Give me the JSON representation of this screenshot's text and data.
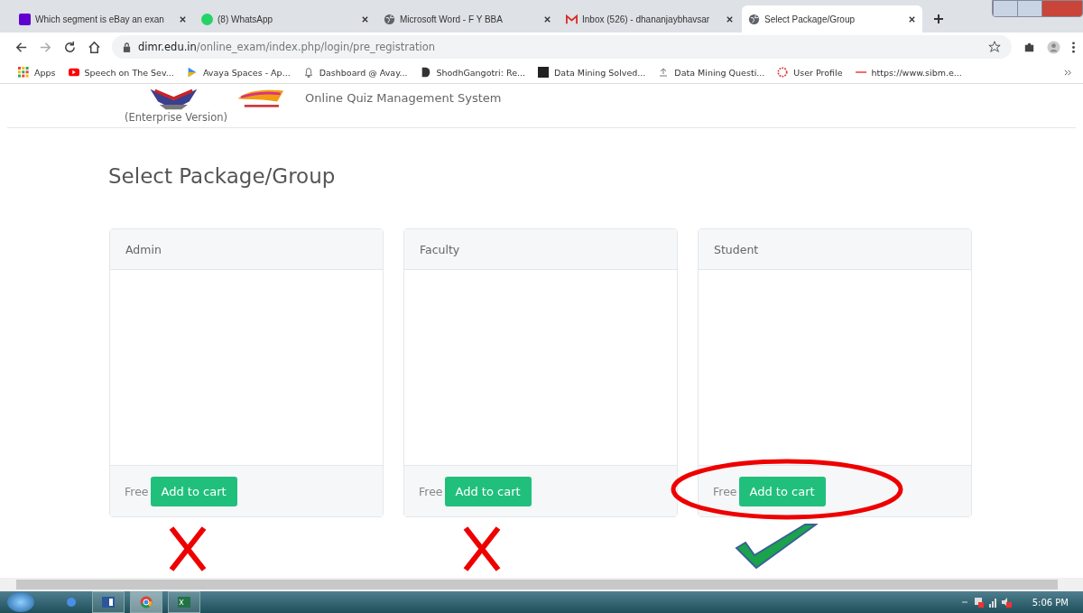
{
  "browser": {
    "tabs": [
      {
        "title": "Which segment is eBay an exan",
        "kind": "yahoo",
        "selected": false
      },
      {
        "title": "(8) WhatsApp",
        "kind": "whatsapp",
        "selected": false
      },
      {
        "title": "Microsoft Word - F Y BBA",
        "kind": "globe",
        "selected": false
      },
      {
        "title": "Inbox (526) - dhananjaybhavsar",
        "kind": "gmail",
        "selected": false
      },
      {
        "title": "Select Package/Group",
        "kind": "globe",
        "selected": true
      }
    ],
    "address": {
      "host": "dimr.edu.in",
      "path": "/online_exam/index.php/login/pre_registration"
    },
    "bookmarks": [
      {
        "label": "Apps",
        "kind": "apps"
      },
      {
        "label": "Speech on The Sev...",
        "kind": "youtube"
      },
      {
        "label": "Avaya Spaces - Ap...",
        "kind": "play"
      },
      {
        "label": "Dashboard @ Avay...",
        "kind": "bell"
      },
      {
        "label": "ShodhGangotri: Re...",
        "kind": "letter"
      },
      {
        "label": "Data Mining Solved...",
        "kind": "square"
      },
      {
        "label": "Data Mining Questi...",
        "kind": "upload"
      },
      {
        "label": "User Profile",
        "kind": "ring"
      },
      {
        "label": "https://www.sibm.e...",
        "kind": "dash"
      }
    ]
  },
  "header": {
    "edition": "(Enterprise Version)",
    "app_name": "Online Quiz Management System"
  },
  "page_title": "Select Package/Group",
  "packages": [
    {
      "name": "Admin",
      "price": "Free",
      "button": "Add to cart",
      "kind": "cross",
      "circled": false
    },
    {
      "name": "Faculty",
      "price": "Free",
      "button": "Add to cart",
      "kind": "cross",
      "circled": false
    },
    {
      "name": "Student",
      "price": "Free",
      "button": "Add to cart",
      "kind": "check",
      "circled": true
    }
  ],
  "taskbar": {
    "time": "5:06 PM"
  }
}
